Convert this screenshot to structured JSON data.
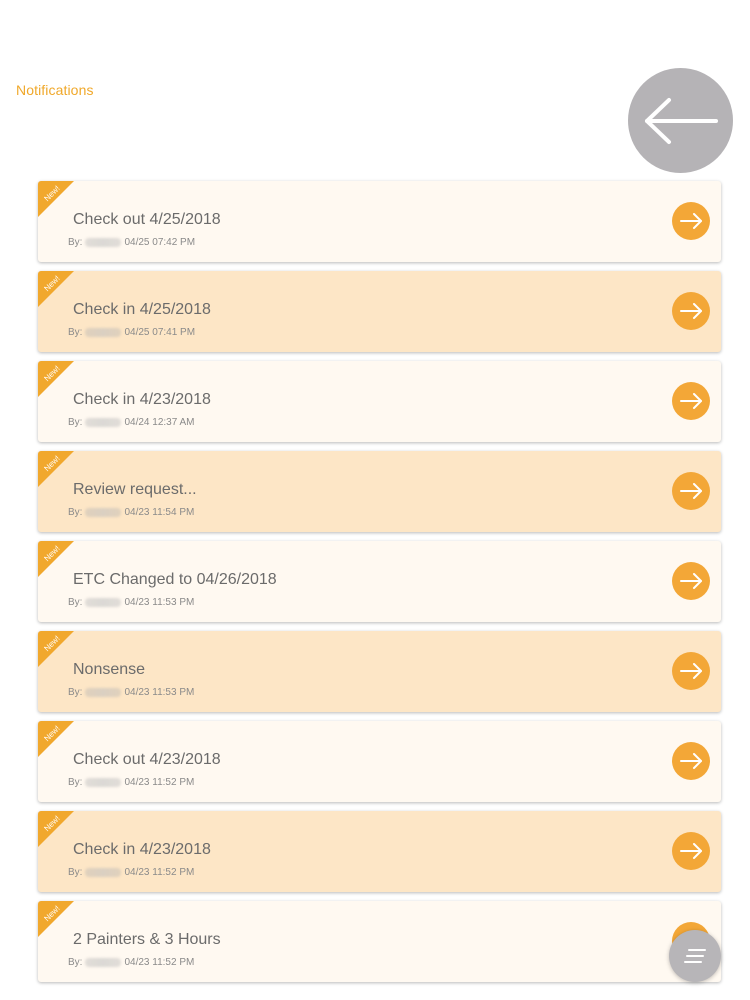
{
  "header": {
    "title": "Notifications",
    "back_icon": "arrow-left-icon"
  },
  "notifications": [
    {
      "badge": "New!",
      "title": "Check out 4/25/2018",
      "by_label": "By:",
      "timestamp": "04/25 07:42 PM"
    },
    {
      "badge": "New!",
      "title": "Check in 4/25/2018",
      "by_label": "By:",
      "timestamp": "04/25 07:41 PM"
    },
    {
      "badge": "New!",
      "title": "Check in 4/23/2018",
      "by_label": "By:",
      "timestamp": "04/24 12:37 AM"
    },
    {
      "badge": "New!",
      "title": "Review request...",
      "by_label": "By:",
      "timestamp": "04/23 11:54 PM"
    },
    {
      "badge": "New!",
      "title": "ETC Changed to 04/26/2018",
      "by_label": "By:",
      "timestamp": "04/23 11:53 PM"
    },
    {
      "badge": "New!",
      "title": "Nonsense",
      "by_label": "By:",
      "timestamp": "04/23 11:53 PM"
    },
    {
      "badge": "New!",
      "title": "Check out 4/23/2018",
      "by_label": "By:",
      "timestamp": "04/23 11:52 PM"
    },
    {
      "badge": "New!",
      "title": "Check in 4/23/2018",
      "by_label": "By:",
      "timestamp": "04/23 11:52 PM"
    },
    {
      "badge": "New!",
      "title": "2 Painters & 3 Hours",
      "by_label": "By:",
      "timestamp": "04/23 11:52 PM"
    }
  ],
  "fab": {
    "icon": "menu-lines-icon"
  },
  "colors": {
    "accent": "#f3a737",
    "title_text": "#f0a82a",
    "row_odd": "#fff9f1",
    "row_even": "#fde6c6",
    "back_button": "#b5b3b6"
  }
}
